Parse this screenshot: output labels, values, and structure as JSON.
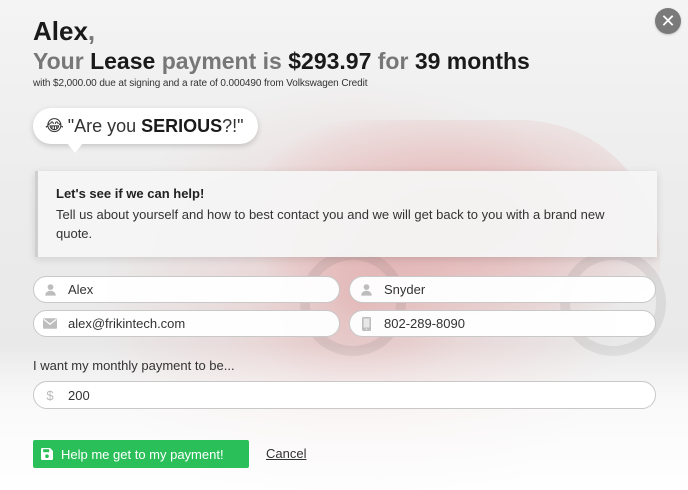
{
  "modal": {
    "close_icon": "close-icon",
    "close_glyph": "✕"
  },
  "header": {
    "name": "Alex",
    "comma": ",",
    "headline": {
      "your": "Your",
      "lease": "Lease",
      "payment_is": "payment is",
      "amount": "$293.97",
      "for": "for",
      "months": "39 months"
    },
    "subtext": "with $2,000.00 due at signing and a rate of 0.000490 from Volkswagen Credit"
  },
  "bubble": {
    "emoji": "😂",
    "prefix": "\"Are you ",
    "emphasis": "SERIOUS",
    "suffix": "?!\""
  },
  "help": {
    "title": "Let's see if we can help!",
    "body": "Tell us about yourself and how to best contact you and we will get back to you with a brand new quote."
  },
  "form": {
    "first_name": {
      "value": "Alex",
      "icon": "user-icon"
    },
    "last_name": {
      "value": "Snyder",
      "icon": "user-icon"
    },
    "email": {
      "value": "alex@frikintech.com",
      "icon": "envelope-icon"
    },
    "phone": {
      "value": "802-289-8090",
      "icon": "phone-icon"
    },
    "payment_label": "I want my monthly payment to be...",
    "payment": {
      "value": "200",
      "icon": "dollar-icon",
      "glyph": "$"
    }
  },
  "actions": {
    "submit_label": "Help me get to my payment!",
    "submit_icon": "save-icon",
    "cancel_label": "Cancel"
  },
  "colors": {
    "accent_green": "#2bbf5a",
    "muted_grey": "#777777"
  }
}
